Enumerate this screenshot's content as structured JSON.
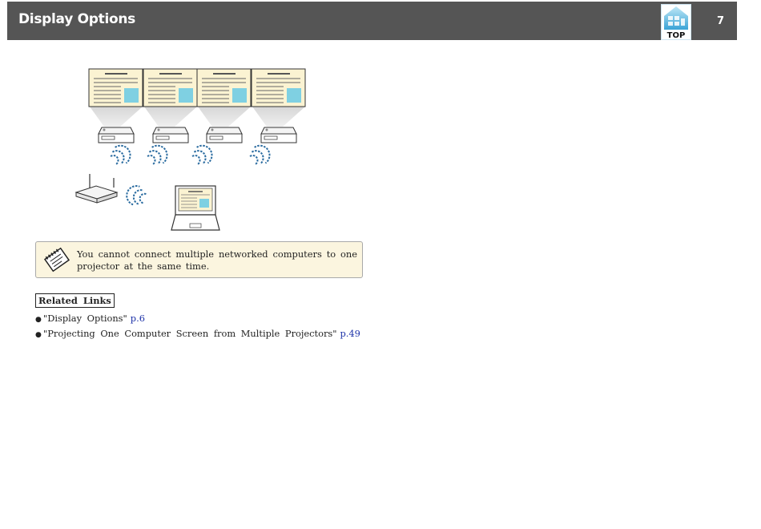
{
  "header": {
    "title": "Display Options",
    "page_number": "7",
    "top_button_label": "TOP"
  },
  "note": {
    "text": "You cannot connect multiple networked computers to one projector at the same time."
  },
  "related_links": {
    "heading": "Related Links",
    "items": [
      {
        "title": "\"Display Options\"",
        "page": "p.6"
      },
      {
        "title": "\"Projecting One Computer Screen from Multiple Projectors\"",
        "page": "p.49"
      }
    ]
  },
  "colors": {
    "header_bg": "#555555",
    "screen_bg": "#fbf3d2",
    "screen_image": "#7fd0e2",
    "wifi_wave": "#2b6ca0",
    "note_bg": "#fbf5df",
    "link": "#1d32a8"
  }
}
